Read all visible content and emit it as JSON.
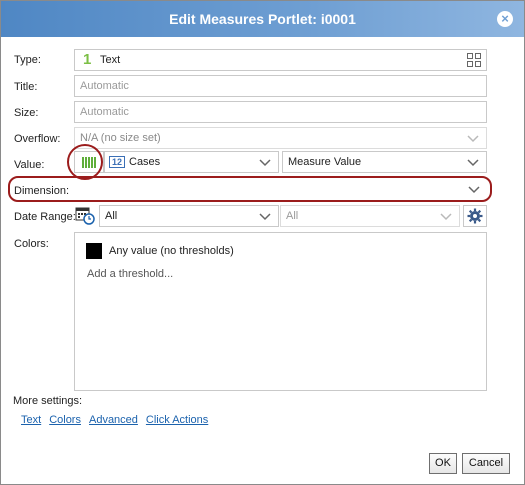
{
  "dialog": {
    "title": "Edit Measures Portlet: i0001"
  },
  "type": {
    "label": "Type:",
    "icon_char": "1",
    "value": "Text"
  },
  "title_field": {
    "label": "Title:",
    "placeholder": "Automatic"
  },
  "size_field": {
    "label": "Size:",
    "placeholder": "Automatic"
  },
  "overflow": {
    "label": "Overflow:",
    "value": "N/A (no size set)"
  },
  "value_row": {
    "label": "Value:",
    "badge": "12",
    "measure": "Cases",
    "agg": "Measure Value"
  },
  "dimension": {
    "label": "Dimension:",
    "value": ""
  },
  "date_range": {
    "label": "Date Range:",
    "from": "All",
    "to": "All"
  },
  "colors": {
    "label": "Colors:",
    "any_value": "Any value (no thresholds)",
    "add_threshold": "Add a threshold..."
  },
  "more": {
    "label": "More settings:",
    "links": [
      "Text",
      "Colors",
      "Advanced",
      "Click Actions"
    ]
  },
  "buttons": {
    "ok": "OK",
    "cancel": "Cancel"
  },
  "accent": {
    "title_bar": "#4f87c4",
    "highlight": "#9b1c1c",
    "type_icon": "#7cbf45",
    "link": "#1b62ad"
  }
}
